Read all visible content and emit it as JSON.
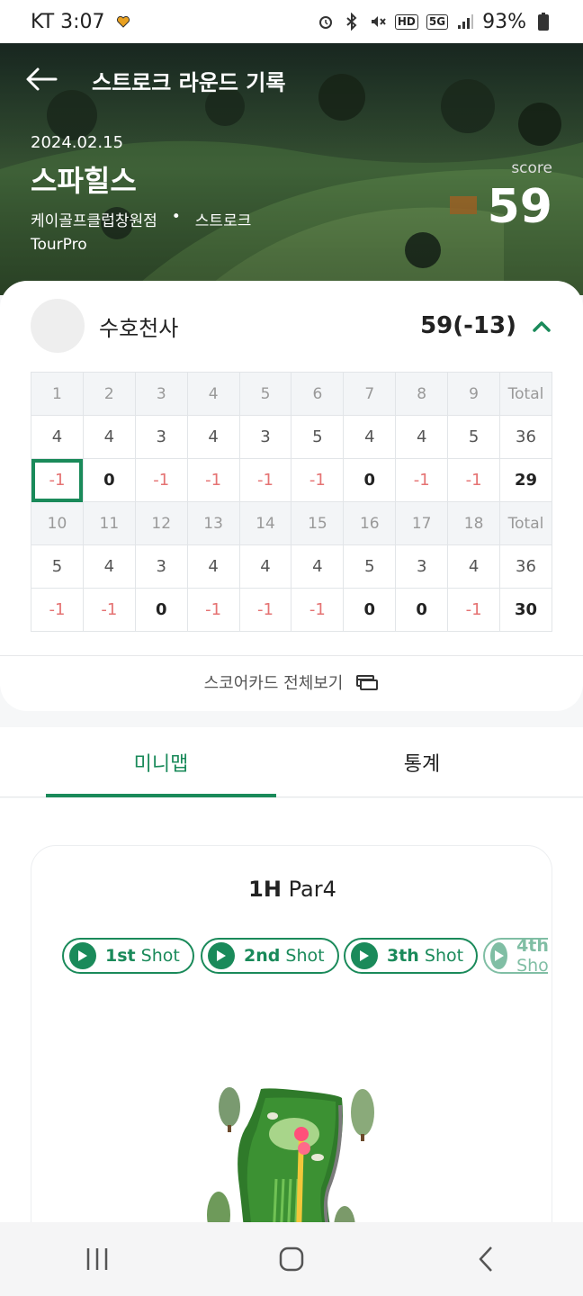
{
  "status_bar": {
    "carrier_time": "KT 3:07",
    "hd_label": "HD",
    "network_label": "5G",
    "battery": "93%"
  },
  "header": {
    "title": "스트로크 라운드 기록",
    "date": "2024.02.15",
    "course": "스파힐스",
    "store": "케이골프클럽창원점",
    "separator": "•",
    "mode": "스트로크",
    "tee": "TourPro",
    "score_label": "score",
    "score": "59"
  },
  "player": {
    "name": "수호천사",
    "score": "59(-13)"
  },
  "scorecard": {
    "front": {
      "holes": [
        "1",
        "2",
        "3",
        "4",
        "5",
        "6",
        "7",
        "8",
        "9",
        "Total"
      ],
      "par": [
        "4",
        "4",
        "3",
        "4",
        "3",
        "5",
        "4",
        "4",
        "5",
        "36"
      ],
      "score": [
        "-1",
        "0",
        "-1",
        "-1",
        "-1",
        "-1",
        "0",
        "-1",
        "-1",
        "29"
      ]
    },
    "back": {
      "holes": [
        "10",
        "11",
        "12",
        "13",
        "14",
        "15",
        "16",
        "17",
        "18",
        "Total"
      ],
      "par": [
        "5",
        "4",
        "3",
        "4",
        "4",
        "4",
        "5",
        "3",
        "4",
        "36"
      ],
      "score": [
        "-1",
        "-1",
        "0",
        "-1",
        "-1",
        "-1",
        "0",
        "0",
        "-1",
        "30"
      ]
    },
    "selected_hole": "1"
  },
  "full_card_link": "스코어카드 전체보기",
  "tabs": [
    {
      "label": "미니맵",
      "active": true
    },
    {
      "label": "통계",
      "active": false
    }
  ],
  "minimap": {
    "hole": "1H",
    "par": "Par4",
    "shots": [
      {
        "num": "1st",
        "word": "Shot"
      },
      {
        "num": "2nd",
        "word": "Shot"
      },
      {
        "num": "3th",
        "word": "Shot"
      },
      {
        "num": "4th",
        "word": "Shot"
      }
    ]
  },
  "colors": {
    "accent": "#1a8a5a",
    "negative": "#e57373"
  }
}
